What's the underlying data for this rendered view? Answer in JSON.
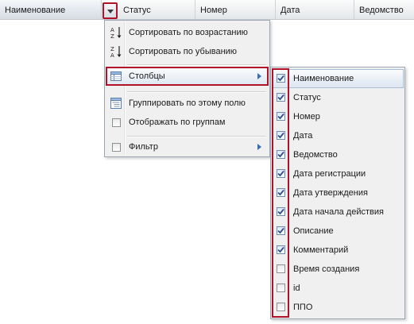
{
  "header": {
    "columns": [
      {
        "label": "Наименование"
      },
      {
        "label": "Статус"
      },
      {
        "label": "Номер"
      },
      {
        "label": "Дата"
      },
      {
        "label": "Ведомство"
      }
    ]
  },
  "menu": {
    "sort_asc": "Сортировать по возрастанию",
    "sort_desc": "Сортировать по убыванию",
    "columns": "Столбцы",
    "group_by": "Группировать по этому полю",
    "show_groups": "Отображать по группам",
    "filter": "Фильтр",
    "show_groups_checked": false,
    "filter_checked": false
  },
  "submenu": {
    "items": [
      {
        "label": "Наименование",
        "checked": true
      },
      {
        "label": "Статус",
        "checked": true
      },
      {
        "label": "Номер",
        "checked": true
      },
      {
        "label": "Дата",
        "checked": true
      },
      {
        "label": "Ведомство",
        "checked": true
      },
      {
        "label": "Дата регистрации",
        "checked": true
      },
      {
        "label": "Дата утверждения",
        "checked": true
      },
      {
        "label": "Дата начала действия",
        "checked": true
      },
      {
        "label": "Описание",
        "checked": true
      },
      {
        "label": "Комментарий",
        "checked": true
      },
      {
        "label": "Время создания",
        "checked": false
      },
      {
        "label": "id",
        "checked": false
      },
      {
        "label": "ППО",
        "checked": false
      }
    ]
  },
  "colors": {
    "highlight_border": "#b1122a",
    "checkmark": "#2a4f8f",
    "submenu_arrow": "#3b6db3"
  }
}
